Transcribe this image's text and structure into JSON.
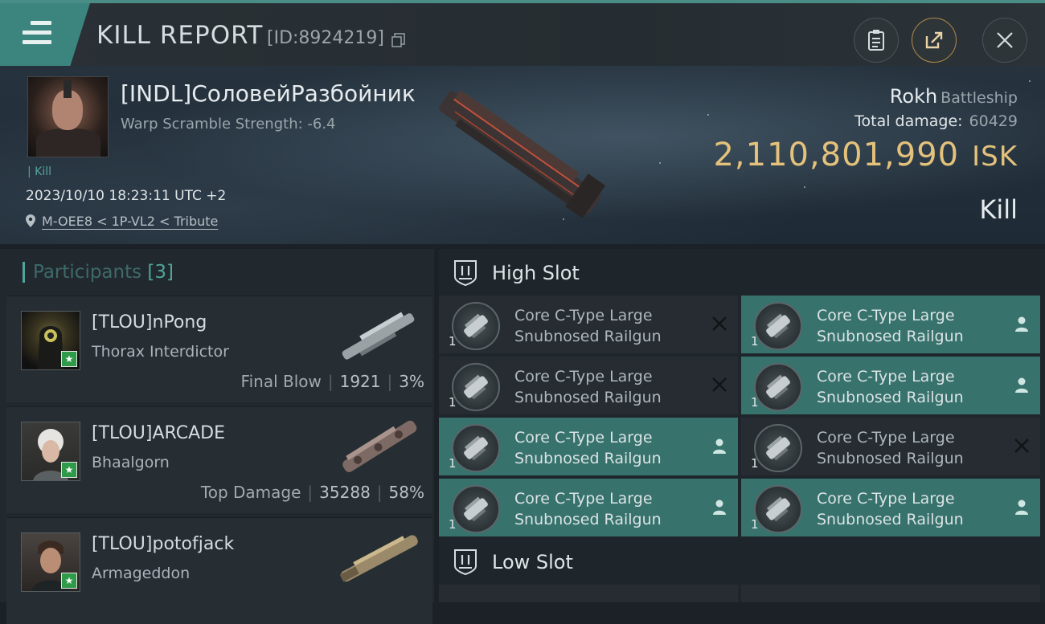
{
  "topbar": {
    "title": "KILL REPORT",
    "kill_id": "[ID:8924219]"
  },
  "victim": {
    "name": "[INDL]СоловейРазбойник",
    "warp_scramble": "Warp Scramble Strength: -6.4",
    "kill_tag": "Kill",
    "datetime": "2023/10/10 18:23:11 UTC +2",
    "location": "M-OEE8 < 1P-VL2 < Tribute",
    "ship_name": "Rokh",
    "ship_class": "Battleship",
    "total_damage_label": "Total damage:",
    "total_damage": "60429",
    "isk_value": "2,110,801,990",
    "isk_unit": "ISK",
    "result": "Kill"
  },
  "participants": {
    "label": "Participants",
    "count": "[3]",
    "items": [
      {
        "name": "[TLOU]nPong",
        "ship": "Thorax Interdictor",
        "tag": "Final Blow",
        "damage": "1921",
        "percent": "3%"
      },
      {
        "name": "[TLOU]ARCADE",
        "ship": "Bhaalgorn",
        "tag": "Top Damage",
        "damage": "35288",
        "percent": "58%"
      },
      {
        "name": "[TLOU]potofjack",
        "ship": "Armageddon",
        "tag": "",
        "damage": "",
        "percent": ""
      }
    ]
  },
  "high_slot": {
    "label": "High Slot",
    "modules": [
      {
        "name": "Core C-Type Large Snubnosed Railgun",
        "qty": "1",
        "state": "destroyed"
      },
      {
        "name": "Core C-Type Large Snubnosed Railgun",
        "qty": "1",
        "state": "dropped"
      },
      {
        "name": "Core C-Type Large Snubnosed Railgun",
        "qty": "1",
        "state": "destroyed"
      },
      {
        "name": "Core C-Type Large Snubnosed Railgun",
        "qty": "1",
        "state": "dropped"
      },
      {
        "name": "Core C-Type Large Snubnosed Railgun",
        "qty": "1",
        "state": "dropped"
      },
      {
        "name": "Core C-Type Large Snubnosed Railgun",
        "qty": "1",
        "state": "destroyed"
      },
      {
        "name": "Core C-Type Large Snubnosed Railgun",
        "qty": "1",
        "state": "dropped"
      },
      {
        "name": "Core C-Type Large Snubnosed Railgun",
        "qty": "1",
        "state": "dropped"
      }
    ]
  },
  "low_slot": {
    "label": "Low Slot"
  },
  "colors": {
    "accent": "#3c857f",
    "isk": "#e4c27b",
    "dropped_bg": "#37726c",
    "destroyed_bg": "#262c31"
  },
  "icons": [
    "menu-icon",
    "copy-icon",
    "clipboard-icon",
    "share-icon",
    "close-icon",
    "location-pin-icon",
    "slot-icon",
    "railgun-icon",
    "person-icon",
    "x-icon"
  ]
}
